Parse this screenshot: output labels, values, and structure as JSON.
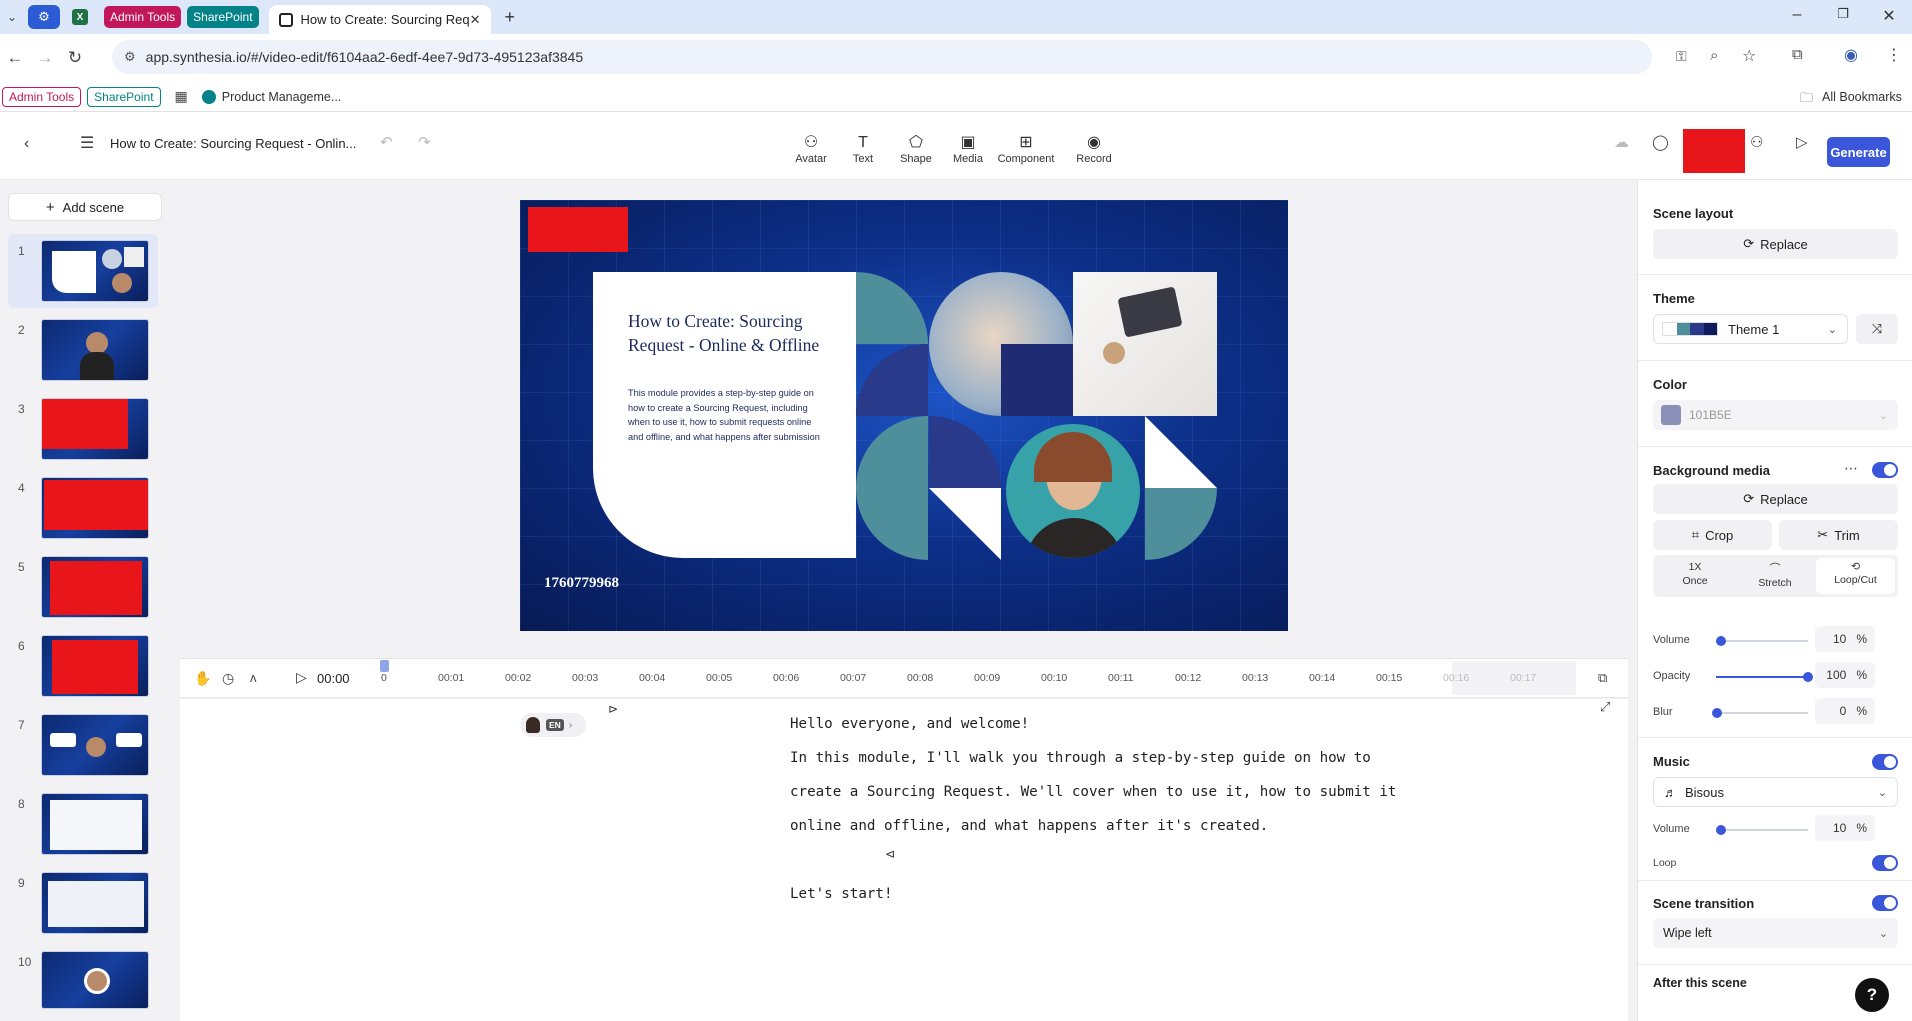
{
  "browser": {
    "tab_pills": [
      {
        "label": "Admin Tools",
        "color": "#c2185b"
      },
      {
        "label": "SharePoint",
        "color": "#038387"
      }
    ],
    "active_tab_title": "How to Create: Sourcing Reque",
    "url": "app.synthesia.io/#/video-edit/f6104aa2-6edf-4ee7-9d73-495123af3845",
    "bookmarks": {
      "admin_tools": "Admin Tools",
      "sharepoint": "SharePoint",
      "product": "Product Manageme...",
      "all_bookmarks": "All Bookmarks"
    }
  },
  "editor": {
    "title": "How to Create: Sourcing Request - Onlin...",
    "tools": [
      "Avatar",
      "Text",
      "Shape",
      "Media",
      "Component",
      "Record"
    ],
    "generate_label": "Generate",
    "add_scene": "Add scene",
    "scene_numbers": [
      "1",
      "2",
      "3",
      "4",
      "5",
      "6",
      "7",
      "8",
      "9",
      "10"
    ]
  },
  "slide": {
    "title": "How to Create: Sourcing Request - Online & Offline",
    "body": "This module provides a step-by-step guide on how to create a Sourcing Request, including when to use it, how to submit requests online and offline, and what happens after submission",
    "number": "1760779968"
  },
  "timeline": {
    "time": "00:00",
    "ticks": [
      "0",
      "00:01",
      "00:02",
      "00:03",
      "00:04",
      "00:05",
      "00:06",
      "00:07",
      "00:08",
      "00:09",
      "00:10",
      "00:11",
      "00:12",
      "00:13",
      "00:14",
      "00:15",
      "00:16",
      "00:17"
    ]
  },
  "script": {
    "lang": "EN",
    "lines": [
      "Hello everyone, and welcome!",
      "In this module, I'll walk you through a step-by-step guide on how to",
      "create a Sourcing Request. We'll cover when to use it, how to submit it",
      "online and offline, and what happens after it's created.",
      "Let's start!"
    ]
  },
  "panel": {
    "scene_layout": "Scene layout",
    "replace": "Replace",
    "theme": "Theme",
    "theme_name": "Theme 1",
    "color": "Color",
    "color_value": "101B5E",
    "background_media": "Background media",
    "crop": "Crop",
    "trim": "Trim",
    "once_top": "1X",
    "once": "Once",
    "stretch": "Stretch",
    "loop_cut": "Loop/Cut",
    "volume": "Volume",
    "volume_value": "10",
    "opacity": "Opacity",
    "opacity_value": "100",
    "blur": "Blur",
    "blur_value": "0",
    "percent": "%",
    "music": "Music",
    "music_track": "Bisous",
    "music_volume_value": "10",
    "loop": "Loop",
    "scene_transition": "Scene transition",
    "transition_value": "Wipe left",
    "after_scene": "After this scene",
    "help": "?"
  },
  "colors": {
    "accent": "#3b57d9",
    "theme_swatch": "#8b90b8"
  }
}
